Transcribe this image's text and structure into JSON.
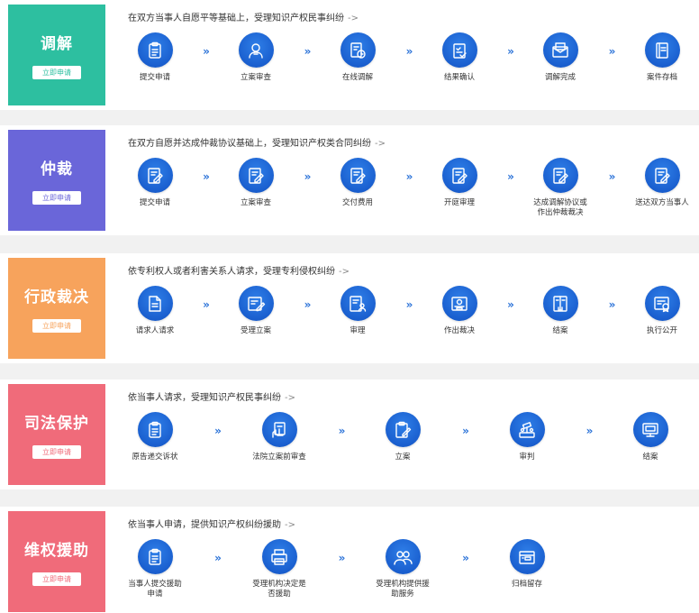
{
  "sections": [
    {
      "id": "mediation",
      "title": "调解",
      "color": "#2dbfa0",
      "button": "立即申请",
      "description": "在双方当事人自愿平等基础上，受理知识产权民事纠纷",
      "arrow": "->",
      "steps": [
        {
          "label": "提交申请",
          "icon": "clipboard-icon"
        },
        {
          "label": "立案审查",
          "icon": "user-review-icon"
        },
        {
          "label": "在线调解",
          "icon": "document-chart-icon"
        },
        {
          "label": "结果确认",
          "icon": "checklist-icon"
        },
        {
          "label": "调解完成",
          "icon": "mail-icon"
        },
        {
          "label": "案件存档",
          "icon": "notebook-icon"
        }
      ]
    },
    {
      "id": "arbitration",
      "title": "仲裁",
      "color": "#6a66d9",
      "button": "立即申请",
      "description": "在双方自愿并达成仲裁协议基础上，受理知识产权类合同纠纷",
      "arrow": "->",
      "steps": [
        {
          "label": "提交申请",
          "icon": "document-sign-icon"
        },
        {
          "label": "立案审查",
          "icon": "document-sign-icon"
        },
        {
          "label": "交付费用",
          "icon": "document-sign-icon"
        },
        {
          "label": "开庭审理",
          "icon": "document-sign-icon"
        },
        {
          "label": "达成调解协议或\n作出仲裁裁决",
          "icon": "document-sign-icon"
        },
        {
          "label": "送达双方当事人",
          "icon": "document-sign-icon"
        }
      ]
    },
    {
      "id": "administrative",
      "title": "行政裁决",
      "color": "#f7a35c",
      "button": "立即申请",
      "description": "依专利权人或者利害关系人请求，受理专利侵权纠纷",
      "arrow": "->",
      "steps": [
        {
          "label": "请求人请求",
          "icon": "document-edit-icon"
        },
        {
          "label": "受理立案",
          "icon": "form-pen-icon"
        },
        {
          "label": "审理",
          "icon": "form-person-icon"
        },
        {
          "label": "作出裁决",
          "icon": "certificate-icon"
        },
        {
          "label": "结案",
          "icon": "book-icon"
        },
        {
          "label": "执行公开",
          "icon": "award-document-icon"
        }
      ]
    },
    {
      "id": "judicial",
      "title": "司法保护",
      "color": "#f06b7a",
      "button": "立即申请",
      "description": "依当事人请求，受理知识产权民事纠纷",
      "arrow": "->",
      "steps": [
        {
          "label": "原告递交诉状",
          "icon": "clipboard-icon"
        },
        {
          "label": "法院立案前审查",
          "icon": "hand-document-icon"
        },
        {
          "label": "立案",
          "icon": "clipboard-pen-icon"
        },
        {
          "label": "审判",
          "icon": "gavel-icon"
        },
        {
          "label": "结案",
          "icon": "monitor-icon"
        }
      ]
    },
    {
      "id": "aid",
      "title": "维权援助",
      "color": "#f06b7a",
      "button": "立即申请",
      "description": "依当事人申请，提供知识产权纠纷援助",
      "arrow": "->",
      "steps": [
        {
          "label": "当事人提交援助\n申请",
          "icon": "clipboard-icon"
        },
        {
          "label": "受理机构决定是\n否援助",
          "icon": "printer-icon"
        },
        {
          "label": "受理机构提供援\n助服务",
          "icon": "people-icon"
        },
        {
          "label": "归档留存",
          "icon": "archive-icon"
        }
      ]
    }
  ],
  "chevron": "»"
}
